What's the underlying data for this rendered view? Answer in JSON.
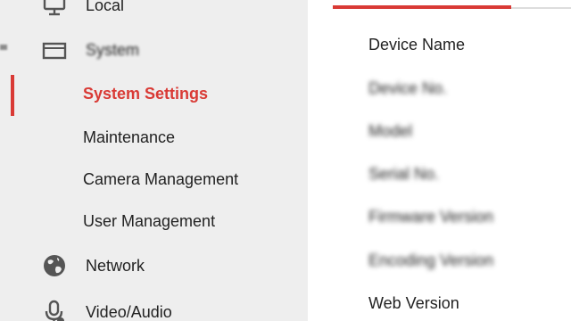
{
  "sidebar": {
    "items": [
      {
        "label": "Local",
        "icon": "monitor-icon"
      },
      {
        "label": "System",
        "icon": "system-icon"
      },
      {
        "label": "System Settings",
        "active": true
      },
      {
        "label": "Maintenance"
      },
      {
        "label": "Camera Management"
      },
      {
        "label": "User Management"
      },
      {
        "label": "Network",
        "icon": "globe-icon"
      },
      {
        "label": "Video/Audio",
        "icon": "microphone-icon"
      }
    ]
  },
  "content": {
    "fields": [
      "Device Name",
      "Device No.",
      "Model",
      "Serial No.",
      "Firmware Version",
      "Encoding Version",
      "Web Version"
    ]
  },
  "colors": {
    "accent": "#d93a35",
    "sidebar_bg": "#eeeeee",
    "text": "#222222"
  }
}
